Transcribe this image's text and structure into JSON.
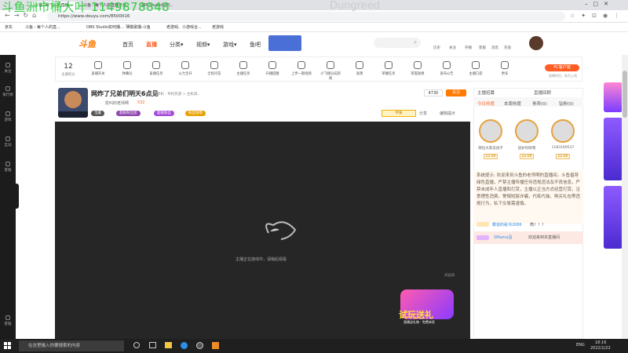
{
  "overlay": {
    "watermark": "斗鱼洲市桶大叶 1149878848",
    "game_title": "Dungreed"
  },
  "browser": {
    "tabs": [
      "斗鱼--每个人的直播...",
      "斗鱼 - 每个人的直播平台",
      "OBS Studio如何..."
    ],
    "url": "https://www.douyu.com/8500016",
    "bookmarks": [
      "京东",
      "斗鱼 - 每个人的直...",
      "OBS Studio如何播...",
      "薄徽歌播-斗鱼",
      "老游戏、小游戏合...",
      "老游戏"
    ]
  },
  "site": {
    "logo": "斗鱼",
    "nav": [
      "首页",
      "直播",
      "分类▾",
      "视频▾",
      "游戏▾",
      "鱼吧"
    ],
    "header_right": [
      "历史",
      "关注",
      "开播",
      "客服",
      "消息",
      "充值",
      "客户中心"
    ]
  },
  "left_sidebar": [
    "关注",
    "排行榜",
    "游戏",
    "互动",
    "客服",
    "客服"
  ],
  "streamer_bar": {
    "level": "12",
    "level_label": "主播积分",
    "items": [
      "直播开关",
      "弹幕玩",
      "直播任务",
      "火力全开",
      "全民问答",
      "主播任务",
      "开播提醒",
      "上传一期视频",
      "小飞猪分成新闻",
      "发牌",
      "荣耀任务",
      "荣誉勋章",
      "发布公告",
      "主播口袋",
      "更多"
    ],
    "pc_button": "PC客户端",
    "pc_sub": "直播伴侣，助力上线"
  },
  "room": {
    "title": "网炸了兄弟们明天6点见",
    "category": "单机 · 单机热游 > 主机再...",
    "streamer": "凯叫的老师啊",
    "popularity": "532",
    "follows": "4730",
    "follow_btn": "关注",
    "report": "举报",
    "share": "分享",
    "edit": "编辑提示",
    "tags": [
      "宝藏",
      "超级粉丝团",
      "超级粉丝",
      "粉丝勋章"
    ]
  },
  "video": {
    "loading": "主播正在连线中，请稍后观看",
    "corner": "高画质",
    "promo": "试玩送礼",
    "promo_sub": "直播送礼物 · 免费体验"
  },
  "chat": {
    "tabs": [
      "主播招募",
      "直播回顾"
    ],
    "subtabs": [
      "今日热度",
      "本周热度",
      "贵宾(0)",
      "钻粉(0)"
    ],
    "ranks": [
      {
        "name": "南拉大家说进子",
        "score": "12.00"
      },
      {
        "name": "鼠驴吗呀嘿",
        "score": "12.00"
      },
      {
        "name": "1183169537",
        "score": "12.00"
      }
    ],
    "system": "系统提示: 欢迎来到斗鱼的老师啊的直播间。斗鱼倡导绿色直播，严禁主播传播任何违规违法及不良信息，严禁未成年人直播和打赏，主播以正当方式经营打赏，注意理性消费。警惕短链诈骗，代练代抽、购买礼包等违规行为，私下交易需谨慎。",
    "msg1_user": "霸道的秘书2686",
    "msg1_text": "芮！！！",
    "msg2_user": "5Mama蛋",
    "msg2_text": "欢迎来到本直播间"
  },
  "taskbar": {
    "search": "在这里输入你要搜索的内容",
    "lang": "ENG",
    "time": "18:16",
    "date": "2022/1/22"
  }
}
